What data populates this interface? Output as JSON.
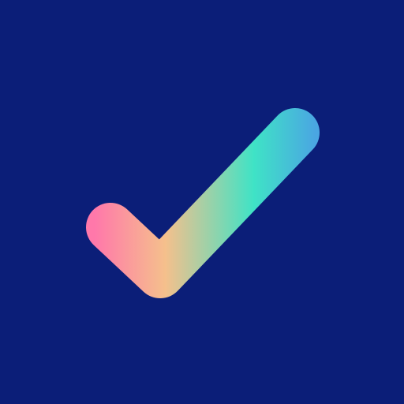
{
  "icon": {
    "name": "checkmark-icon",
    "background_color": "#0b1e78",
    "gradient": {
      "stop_colors": [
        "#ff78aa",
        "#f5c08c",
        "#3fe3c6",
        "#4aa6e2"
      ]
    }
  }
}
